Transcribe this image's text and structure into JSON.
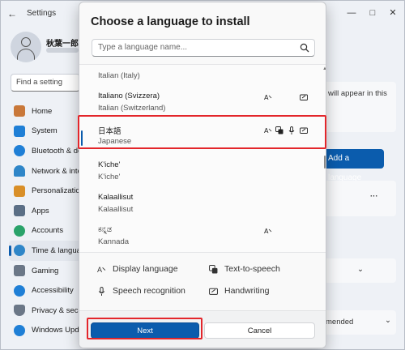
{
  "settings": {
    "window_title": "Settings",
    "back_icon": "back-arrow-icon",
    "controls": [
      "minimize-icon",
      "maximize-icon",
      "close-icon"
    ],
    "user_name": "秋葉一郎",
    "search_placeholder": "Find a setting",
    "nav": [
      {
        "label": "Home",
        "icon": "home-icon",
        "color": "#c9783a"
      },
      {
        "label": "System",
        "icon": "system-icon",
        "color": "#1f7fd6"
      },
      {
        "label": "Bluetooth & de",
        "icon": "bluetooth-icon",
        "color": "#1f7fd6"
      },
      {
        "label": "Network & inte",
        "icon": "network-icon",
        "color": "#2f86c8"
      },
      {
        "label": "Personalization",
        "icon": "brush-icon",
        "color": "#d98f28"
      },
      {
        "label": "Apps",
        "icon": "apps-icon",
        "color": "#5b6f86"
      },
      {
        "label": "Accounts",
        "icon": "accounts-icon",
        "color": "#2aa36a"
      },
      {
        "label": "Time & languag",
        "icon": "time-language-icon",
        "color": "#2f86c8"
      },
      {
        "label": "Gaming",
        "icon": "gaming-icon",
        "color": "#6b7787"
      },
      {
        "label": "Accessibility",
        "icon": "accessibility-icon",
        "color": "#1f7fd6"
      },
      {
        "label": "Privacy & secu",
        "icon": "shield-icon",
        "color": "#6b7787"
      },
      {
        "label": "Windows Upda",
        "icon": "update-icon",
        "color": "#1f7fd6"
      }
    ],
    "right_fragment_text": "will appear in this",
    "add_language_label": "Add a language",
    "right_dropdown_value": "mended"
  },
  "dialog": {
    "title": "Choose a language to install",
    "search_placeholder": "Type a language name...",
    "languages": [
      {
        "name": "",
        "native": "Italian (Italy)",
        "features": [
          "display"
        ]
      },
      {
        "name": "Italiano (Svizzera)",
        "native": "Italian (Switzerland)",
        "features": [
          "display",
          "handwriting"
        ]
      },
      {
        "name": "日本語",
        "native": "Japanese",
        "features": [
          "display",
          "tts",
          "speech",
          "handwriting"
        ],
        "selected": true
      },
      {
        "name": "K'iche'",
        "native": "K'iche'",
        "features": []
      },
      {
        "name": "Kalaallisut",
        "native": "Kalaallisut",
        "features": []
      },
      {
        "name": "ಕನ್ನಡ",
        "native": "Kannada",
        "features": [
          "display"
        ]
      }
    ],
    "legend": {
      "display": "Display language",
      "tts": "Text-to-speech",
      "speech": "Speech recognition",
      "handwriting": "Handwriting"
    },
    "next_label": "Next",
    "cancel_label": "Cancel"
  },
  "colors": {
    "accent": "#0b5cad",
    "highlight": "#e3262b"
  }
}
